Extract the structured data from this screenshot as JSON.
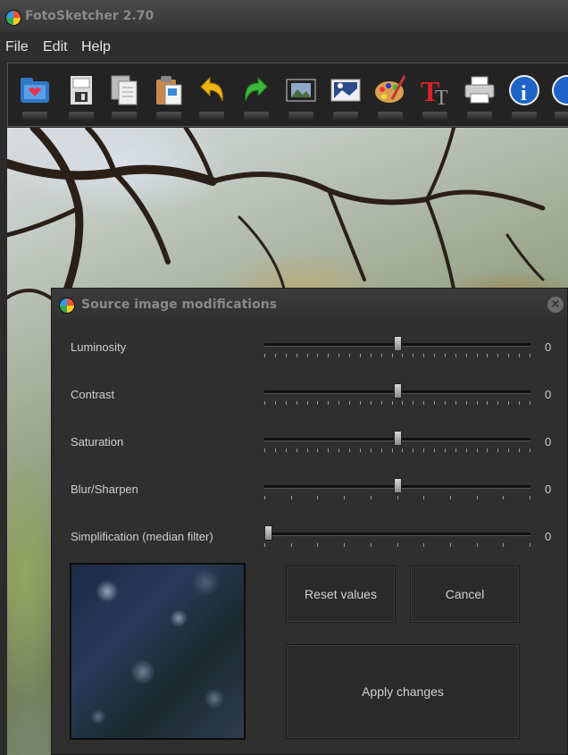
{
  "window": {
    "title": "FotoSketcher 2.70"
  },
  "menu": {
    "items": [
      "File",
      "Edit",
      "Help"
    ]
  },
  "toolbar": {
    "tools": [
      "open-folder-icon",
      "save-icon",
      "copy-icon",
      "paste-icon",
      "undo-icon",
      "redo-icon",
      "film-frame-icon",
      "image-landscape-icon",
      "palette-icon",
      "text-icon",
      "print-icon",
      "info-icon",
      "help-icon"
    ]
  },
  "dialog": {
    "title": "Source image modifications",
    "close": "×",
    "sliders": [
      {
        "label": "Luminosity",
        "value": "0",
        "level": 0.5
      },
      {
        "label": "Contrast",
        "value": "0",
        "level": 0.5
      },
      {
        "label": "Saturation",
        "value": "0",
        "level": 0.5
      },
      {
        "label": "Blur/Sharpen",
        "value": "0",
        "level": 0.5
      },
      {
        "label": "Simplification (median filter)",
        "value": "0",
        "level": 0.0
      }
    ],
    "buttons": {
      "reset": "Reset values",
      "cancel": "Cancel",
      "apply": "Apply changes"
    }
  }
}
